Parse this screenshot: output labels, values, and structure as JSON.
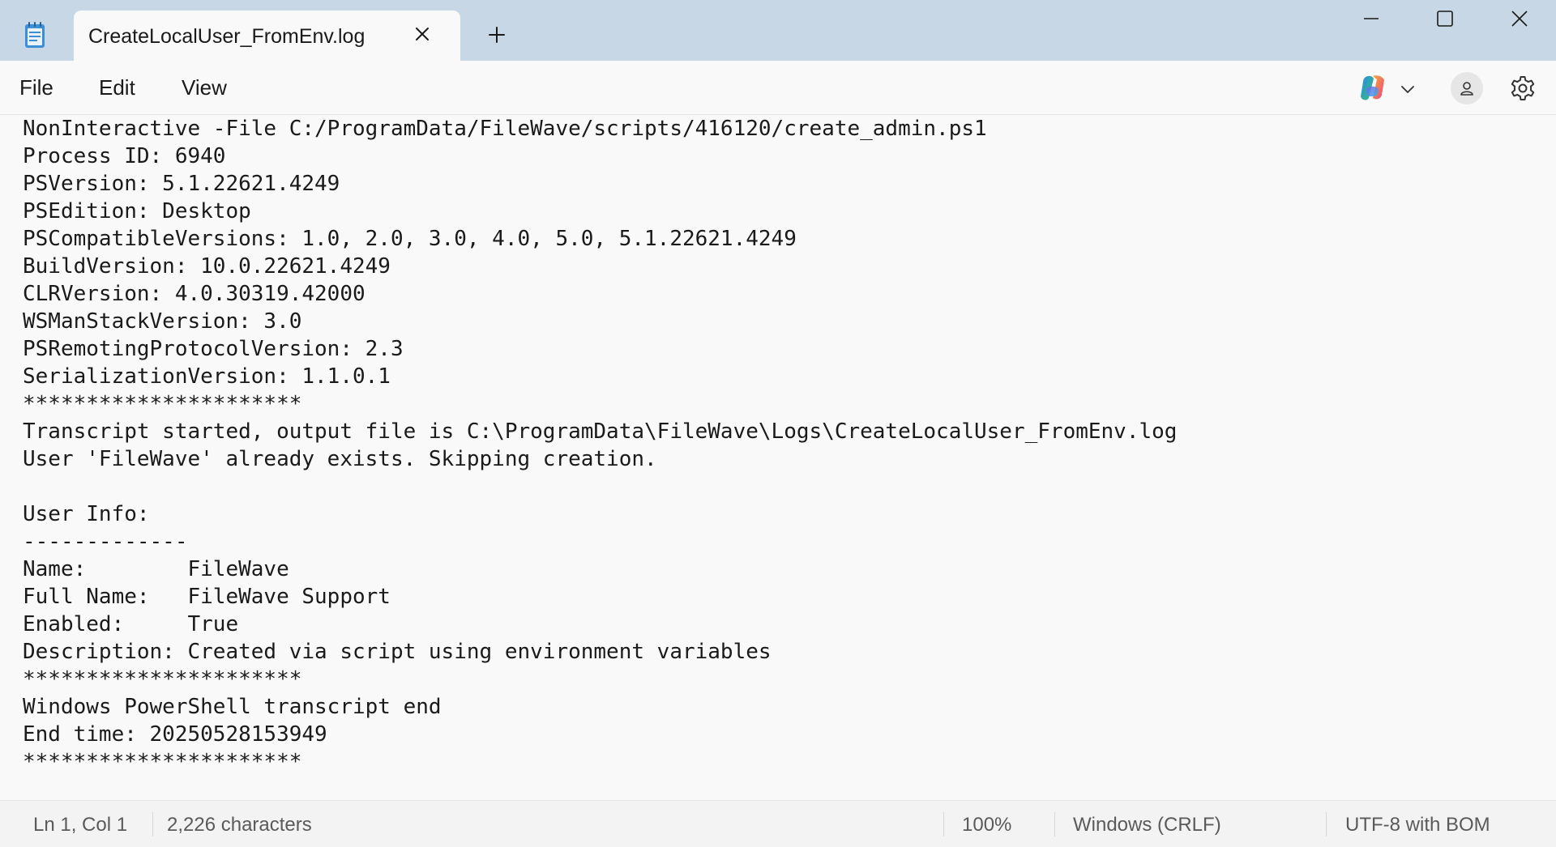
{
  "tab": {
    "title": "CreateLocalUser_FromEnv.log"
  },
  "menu": {
    "file": "File",
    "edit": "Edit",
    "view": "View"
  },
  "icons": {
    "app": "notepad-icon",
    "close_tab": "close-icon",
    "new_tab": "plus-icon",
    "copilot": "copilot-icon",
    "account": "account-icon",
    "settings": "gear-icon"
  },
  "editor": {
    "lines": [
      "NonInteractive -File C:/ProgramData/FileWave/scripts/416120/create_admin.ps1",
      "Process ID: 6940",
      "PSVersion: 5.1.22621.4249",
      "PSEdition: Desktop",
      "PSCompatibleVersions: 1.0, 2.0, 3.0, 4.0, 5.0, 5.1.22621.4249",
      "BuildVersion: 10.0.22621.4249",
      "CLRVersion: 4.0.30319.42000",
      "WSManStackVersion: 3.0",
      "PSRemotingProtocolVersion: 2.3",
      "SerializationVersion: 1.1.0.1",
      "**********************",
      "Transcript started, output file is C:\\ProgramData\\FileWave\\Logs\\CreateLocalUser_FromEnv.log",
      "User 'FileWave' already exists. Skipping creation.",
      "",
      "User Info:",
      "-------------",
      "Name:        FileWave",
      "Full Name:   FileWave Support",
      "Enabled:     True",
      "Description: Created via script using environment variables",
      "**********************",
      "Windows PowerShell transcript end",
      "End time: 20250528153949",
      "**********************"
    ]
  },
  "status": {
    "position": "Ln 1, Col 1",
    "characters": "2,226 characters",
    "zoom": "100%",
    "line_endings": "Windows (CRLF)",
    "encoding": "UTF-8 with BOM"
  },
  "colors": {
    "titlebar": "#c7d7e5",
    "background": "#f9f9f9",
    "text": "#1a1a1a",
    "status_text": "#5a5a5a"
  }
}
